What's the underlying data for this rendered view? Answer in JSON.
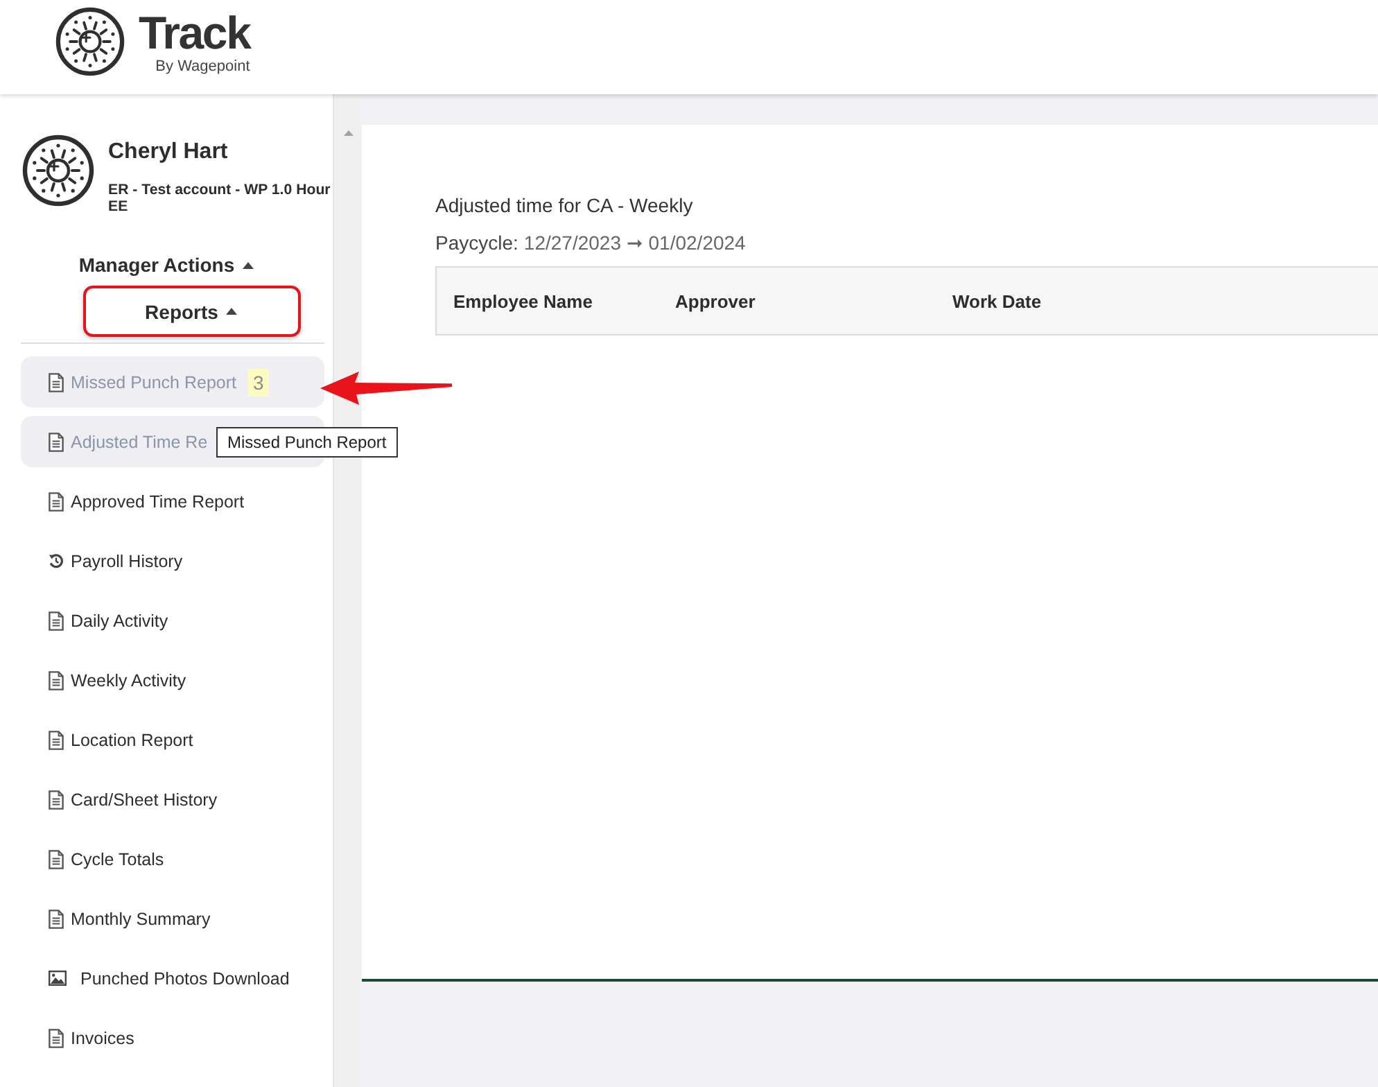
{
  "header": {
    "brand": "Track",
    "tagline": "By Wagepoint"
  },
  "sidebar": {
    "user": {
      "name": "Cheryl Hart",
      "account_lines": [
        "ER - Test account - WP 1.0 Hour",
        "EE"
      ]
    },
    "sections": [
      {
        "label": "Manager Actions",
        "expanded": true,
        "highlighted": false
      },
      {
        "label": "Reports",
        "expanded": true,
        "highlighted": true
      }
    ],
    "items": [
      {
        "kind": "document",
        "label": "Missed Punch Report",
        "badge": "3",
        "selected": true
      },
      {
        "kind": "document",
        "label": "Adjusted Time Re",
        "selected": true
      },
      {
        "kind": "document",
        "label": "Approved Time Report",
        "selected": false
      },
      {
        "kind": "history",
        "label": "Payroll History",
        "selected": false
      },
      {
        "kind": "document",
        "label": "Daily Activity",
        "selected": false
      },
      {
        "kind": "document",
        "label": "Weekly Activity",
        "selected": false
      },
      {
        "kind": "document",
        "label": "Location Report",
        "selected": false
      },
      {
        "kind": "document",
        "label": "Card/Sheet History",
        "selected": false
      },
      {
        "kind": "document",
        "label": "Cycle Totals",
        "selected": false
      },
      {
        "kind": "document",
        "label": "Monthly Summary",
        "selected": false
      },
      {
        "kind": "image",
        "label": "Punched Photos Download",
        "selected": false
      },
      {
        "kind": "document",
        "label": "Invoices",
        "selected": false
      }
    ],
    "tooltip": "Missed Punch Report"
  },
  "main": {
    "title": "Adjusted time for CA - Weekly",
    "paycycle_label": "Paycycle:",
    "paycycle_dates": "12/27/2023 ➞ 01/02/2024",
    "table": {
      "columns": [
        "Employee Name",
        "Approver",
        "Work Date"
      ]
    }
  }
}
